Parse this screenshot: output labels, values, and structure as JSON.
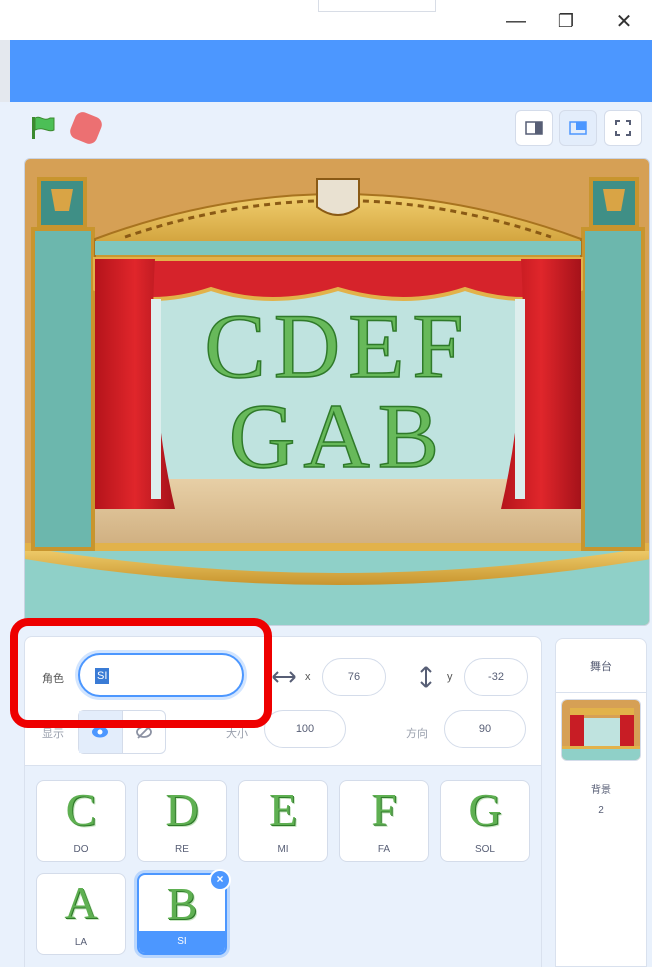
{
  "window": {
    "minimize_symbol": "—",
    "restore_symbol": "❐",
    "close_symbol": "✕"
  },
  "stage": {
    "letters_line1": "CDEF",
    "letters_line2": "GAB"
  },
  "sprite_info": {
    "name_label": "角色",
    "name_value": "SI",
    "x_value": "76",
    "y_value": "-32",
    "show_label": "显示",
    "size_label": "大小",
    "size_value": "100",
    "direction_label": "方向",
    "direction_value": "90"
  },
  "sprites": [
    {
      "glyph": "C",
      "name": "DO"
    },
    {
      "glyph": "D",
      "name": "RE"
    },
    {
      "glyph": "E",
      "name": "MI"
    },
    {
      "glyph": "F",
      "name": "FA"
    },
    {
      "glyph": "G",
      "name": "SOL"
    },
    {
      "glyph": "A",
      "name": "LA"
    },
    {
      "glyph": "B",
      "name": "SI"
    }
  ],
  "stage_panel": {
    "title": "舞台",
    "backdrop_label": "背景",
    "backdrop_count": "2"
  },
  "colors": {
    "accent": "#4c97ff",
    "highlight": "#ee0000",
    "letter_green": "#5fb052"
  }
}
